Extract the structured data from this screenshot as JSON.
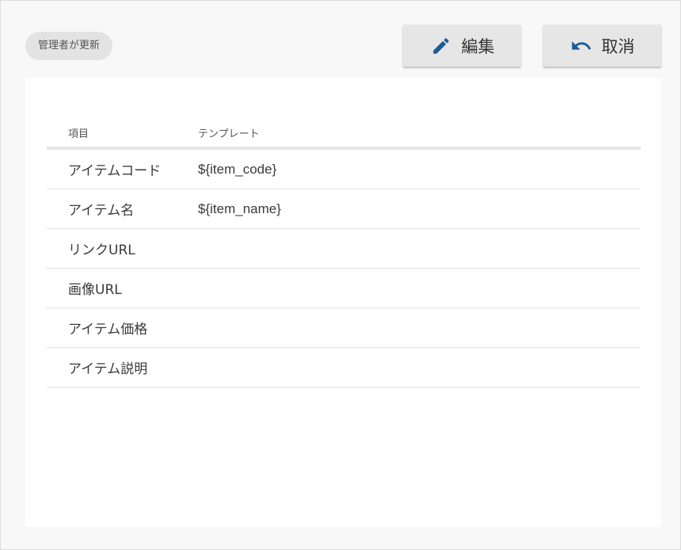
{
  "status_chip": "管理者が更新",
  "toolbar": {
    "edit_label": "編集",
    "edit_icon": "pencil-icon",
    "cancel_label": "取消",
    "cancel_icon": "undo-icon",
    "icon_color": "#1f5b94"
  },
  "table": {
    "headers": [
      "項目",
      "テンプレート"
    ],
    "rows": [
      {
        "item": "アイテムコード",
        "template": "${item_code}"
      },
      {
        "item": "アイテム名",
        "template": "${item_name}"
      },
      {
        "item": "リンクURL",
        "template": ""
      },
      {
        "item": "画像URL",
        "template": ""
      },
      {
        "item": "アイテム価格",
        "template": ""
      },
      {
        "item": "アイテム説明",
        "template": ""
      }
    ]
  }
}
